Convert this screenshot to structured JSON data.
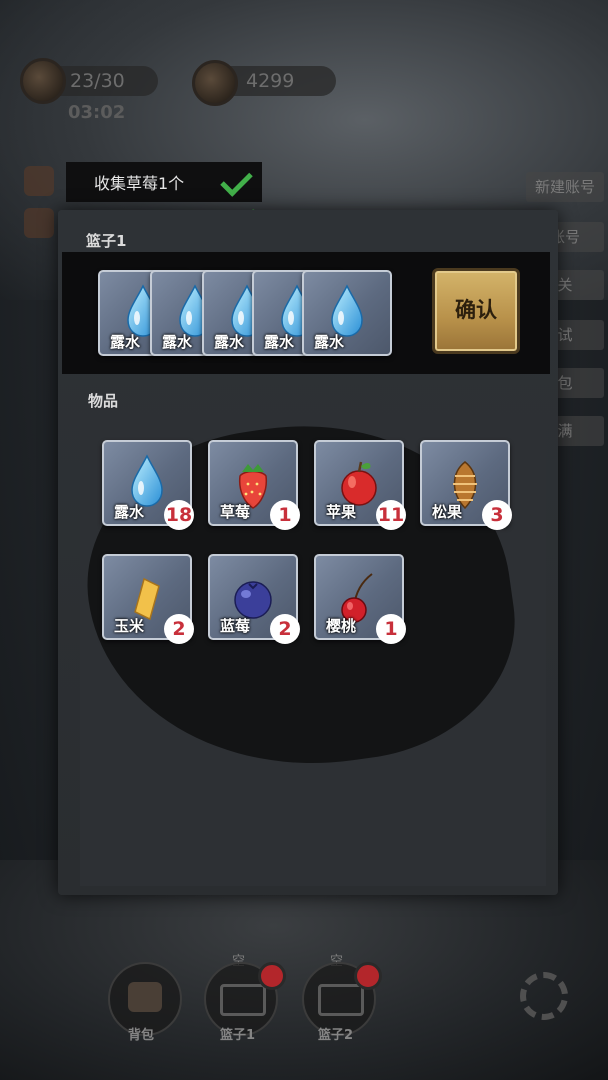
{
  "hud": {
    "energy": "23/30",
    "coins": "4299",
    "timer": "03:02"
  },
  "task": {
    "text": "收集草莓1个"
  },
  "right_tabs": [
    "新建账号",
    "账号",
    "关",
    "试",
    "包",
    "满"
  ],
  "basket": {
    "title": "篮子1",
    "items": [
      {
        "name": "露水",
        "icon": "water-drop-icon"
      },
      {
        "name": "露水",
        "icon": "water-drop-icon"
      },
      {
        "name": "露水",
        "icon": "water-drop-icon"
      },
      {
        "name": "露水",
        "icon": "water-drop-icon"
      },
      {
        "name": "露水",
        "icon": "water-drop-icon"
      }
    ],
    "confirm_label": "确认"
  },
  "inventory": {
    "title": "物品",
    "items": [
      {
        "name": "露水",
        "count": "18",
        "icon": "water-drop-icon"
      },
      {
        "name": "草莓",
        "count": "1",
        "icon": "strawberry-icon"
      },
      {
        "name": "苹果",
        "count": "11",
        "icon": "apple-icon"
      },
      {
        "name": "松果",
        "count": "3",
        "icon": "pinecone-icon"
      },
      {
        "name": "玉米",
        "count": "2",
        "icon": "corn-icon"
      },
      {
        "name": "蓝莓",
        "count": "2",
        "icon": "blueberry-icon"
      },
      {
        "name": "樱桃",
        "count": "1",
        "icon": "cherry-icon"
      }
    ]
  },
  "bottom_bar": {
    "backpack_label": "背包",
    "basket1_label": "篮子1",
    "basket1_status": "空",
    "basket2_label": "篮子2",
    "basket2_status": "空"
  },
  "colors": {
    "badge_text": "#c8303b",
    "check": "#42b04a",
    "confirm_bg": "#c9a45a",
    "notification_dot": "#b3262b"
  }
}
